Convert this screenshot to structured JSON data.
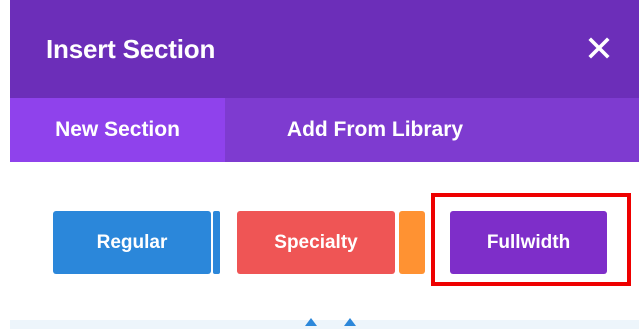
{
  "modal": {
    "title": "Insert Section",
    "close_icon": "close-icon"
  },
  "tabs": [
    {
      "label": "New Section",
      "active": true
    },
    {
      "label": "Add From Library",
      "active": false
    }
  ],
  "section_types": [
    {
      "label": "Regular",
      "color": "#2b87da"
    },
    {
      "label": "Specialty",
      "color": "#ef5555",
      "accent": "#ff9232"
    },
    {
      "label": "Fullwidth",
      "color": "#7e2ec9",
      "highlighted": true
    }
  ],
  "colors": {
    "header": "#6c2eb9",
    "tab_bar": "#7e3bd0",
    "tab_active": "#8f42ec",
    "highlight": "#ee0000"
  }
}
